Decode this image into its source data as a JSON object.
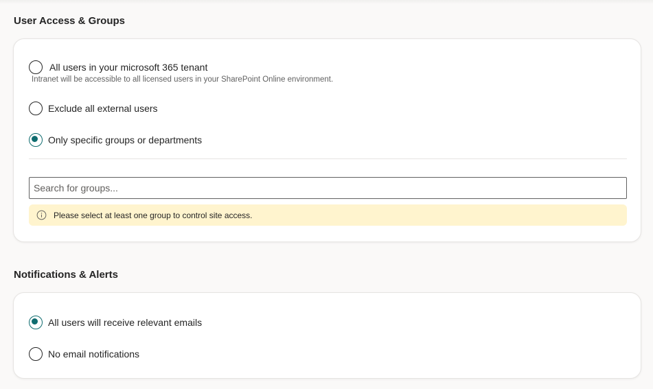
{
  "user_access": {
    "title": "User Access & Groups",
    "options": [
      {
        "label": "All users in your microsoft 365 tenant",
        "hint": "Intranet will be accessible to all licensed users in your SharePoint Online environment.",
        "checked": false
      },
      {
        "label": "Exclude all external users",
        "checked": false
      },
      {
        "label": "Only specific groups or departments",
        "checked": true
      }
    ],
    "search_placeholder": "Search for groups...",
    "warning": "Please select at least one group to control site access.",
    "warning_icon": "info-icon"
  },
  "notifications": {
    "title": "Notifications & Alerts",
    "options": [
      {
        "label": "All users will receive relevant emails",
        "checked": true
      },
      {
        "label": "No email notifications",
        "checked": false
      }
    ]
  },
  "colors": {
    "accent": "#0f6c6f",
    "warning_bg": "#fff4ce",
    "page_bg": "#faf9f8"
  }
}
